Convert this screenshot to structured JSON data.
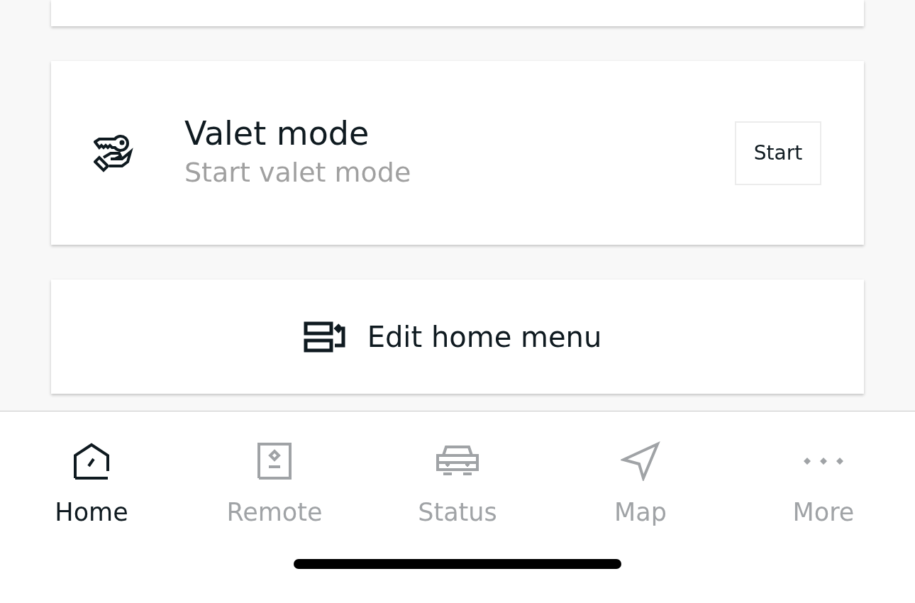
{
  "valet": {
    "title": "Valet mode",
    "subtitle": "Start valet mode",
    "button": "Start"
  },
  "edit_menu": {
    "label": "Edit home menu"
  },
  "tab_bar": [
    {
      "kind": "home",
      "label": "Home",
      "selected": true
    },
    {
      "kind": "remote",
      "label": "Remote",
      "selected": false
    },
    {
      "kind": "status",
      "label": "Status",
      "selected": false
    },
    {
      "kind": "map",
      "label": "Map",
      "selected": false
    },
    {
      "kind": "more",
      "label": "More",
      "selected": false
    }
  ]
}
